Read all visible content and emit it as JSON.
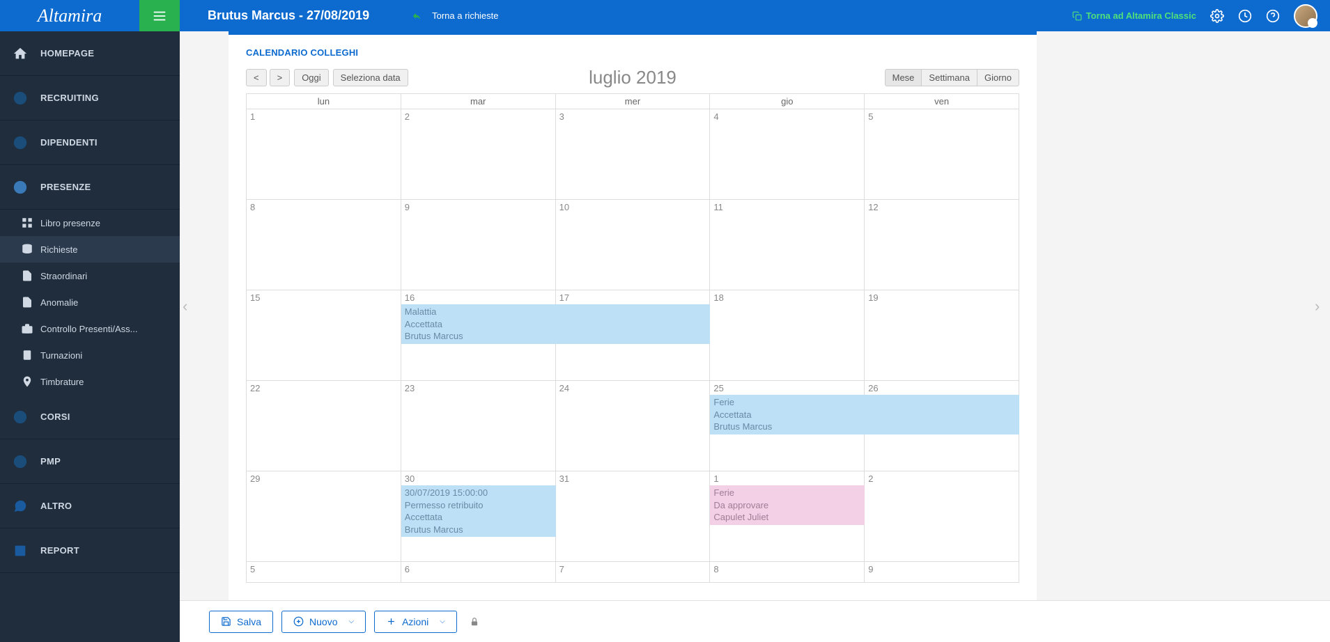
{
  "header": {
    "logo": "Altamira",
    "title": "Brutus Marcus - 27/08/2019",
    "back": "Torna a richieste",
    "classic": "Torna ad Altamira Classic"
  },
  "sidebar": {
    "items": [
      {
        "label": "HOMEPAGE"
      },
      {
        "label": "RECRUITING"
      },
      {
        "label": "DIPENDENTI"
      },
      {
        "label": "PRESENZE"
      },
      {
        "label": "CORSI"
      },
      {
        "label": "PMP"
      },
      {
        "label": "ALTRO"
      },
      {
        "label": "REPORT"
      }
    ],
    "sub": [
      {
        "label": "Libro presenze"
      },
      {
        "label": "Richieste"
      },
      {
        "label": "Straordinari"
      },
      {
        "label": "Anomalie"
      },
      {
        "label": "Controllo Presenti/Ass..."
      },
      {
        "label": "Turnazioni"
      },
      {
        "label": "Timbrature"
      }
    ]
  },
  "section": {
    "title": "CALENDARIO COLLEGHI"
  },
  "cal": {
    "prev": "<",
    "next": ">",
    "today": "Oggi",
    "pick": "Seleziona data",
    "title": "luglio 2019",
    "views": {
      "m": "Mese",
      "w": "Settimana",
      "d": "Giorno"
    },
    "days": [
      "lun",
      "mar",
      "mer",
      "gio",
      "ven"
    ],
    "grid": [
      [
        "1",
        "2",
        "3",
        "4",
        "5"
      ],
      [
        "8",
        "9",
        "10",
        "11",
        "12"
      ],
      [
        "15",
        "16",
        "17",
        "18",
        "19"
      ],
      [
        "22",
        "23",
        "24",
        "25",
        "26"
      ],
      [
        "29",
        "30",
        "31",
        "1",
        "2"
      ],
      [
        "5",
        "6",
        "7",
        "8",
        "9"
      ]
    ],
    "events": {
      "e1": {
        "l1": "Malattia",
        "l2": "Accettata",
        "l3": "Brutus Marcus"
      },
      "e2": {
        "l1": "Ferie",
        "l2": "Accettata",
        "l3": "Brutus Marcus"
      },
      "e3": {
        "l1": "30/07/2019 15:00:00",
        "l2": "Permesso retribuito",
        "l3": "Accettata",
        "l4": "Brutus Marcus"
      },
      "e4": {
        "l1": "Ferie",
        "l2": "Da approvare",
        "l3": "Capulet Juliet"
      }
    }
  },
  "actions": {
    "save": "Salva",
    "new": "Nuovo",
    "act": "Azioni"
  }
}
